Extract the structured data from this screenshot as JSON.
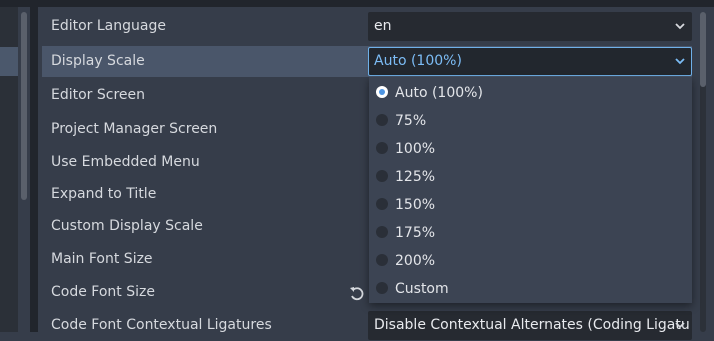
{
  "settings": {
    "rows": [
      {
        "label": "Editor Language",
        "value": "en"
      },
      {
        "label": "Display Scale",
        "value": "Auto (100%)"
      },
      {
        "label": "Editor Screen"
      },
      {
        "label": "Project Manager Screen"
      },
      {
        "label": "Use Embedded Menu"
      },
      {
        "label": "Expand to Title"
      },
      {
        "label": "Custom Display Scale"
      },
      {
        "label": "Main Font Size"
      },
      {
        "label": "Code Font Size"
      },
      {
        "label": "Code Font Contextual Ligatures",
        "value": "Disable Contextual Alternates (Coding Ligatu"
      }
    ]
  },
  "dropdown": {
    "selected": "Auto (100%)",
    "options": [
      "Auto (100%)",
      "75%",
      "100%",
      "125%",
      "150%",
      "175%",
      "200%",
      "Custom"
    ]
  },
  "icons": {
    "revert": "revert-icon",
    "chevron": "chevron-down-icon"
  },
  "colors": {
    "accent": "#6fb0e8",
    "selected_row": "#4a566a",
    "panel_bg": "#363d4a"
  }
}
